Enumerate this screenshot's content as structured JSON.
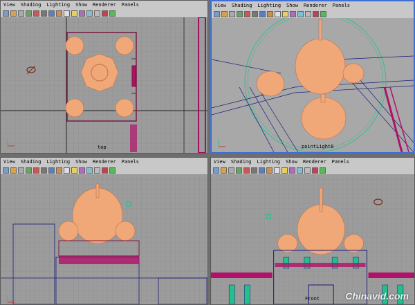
{
  "menu": [
    "View",
    "Shading",
    "Lighting",
    "Show",
    "Renderer",
    "Panels"
  ],
  "panes": [
    {
      "id": "top",
      "label": "top"
    },
    {
      "id": "persp",
      "label": "pointLight8"
    },
    {
      "id": "side",
      "label": ""
    },
    {
      "id": "front",
      "label": "Front"
    }
  ],
  "watermark": "Chinavid.com",
  "colors": {
    "wire": "#f0a878",
    "grid": "#8c8c8c",
    "active": "#3f6fd6",
    "blue": "#2b2ba8",
    "magenta": "#b0126a",
    "green": "#22c08a"
  }
}
